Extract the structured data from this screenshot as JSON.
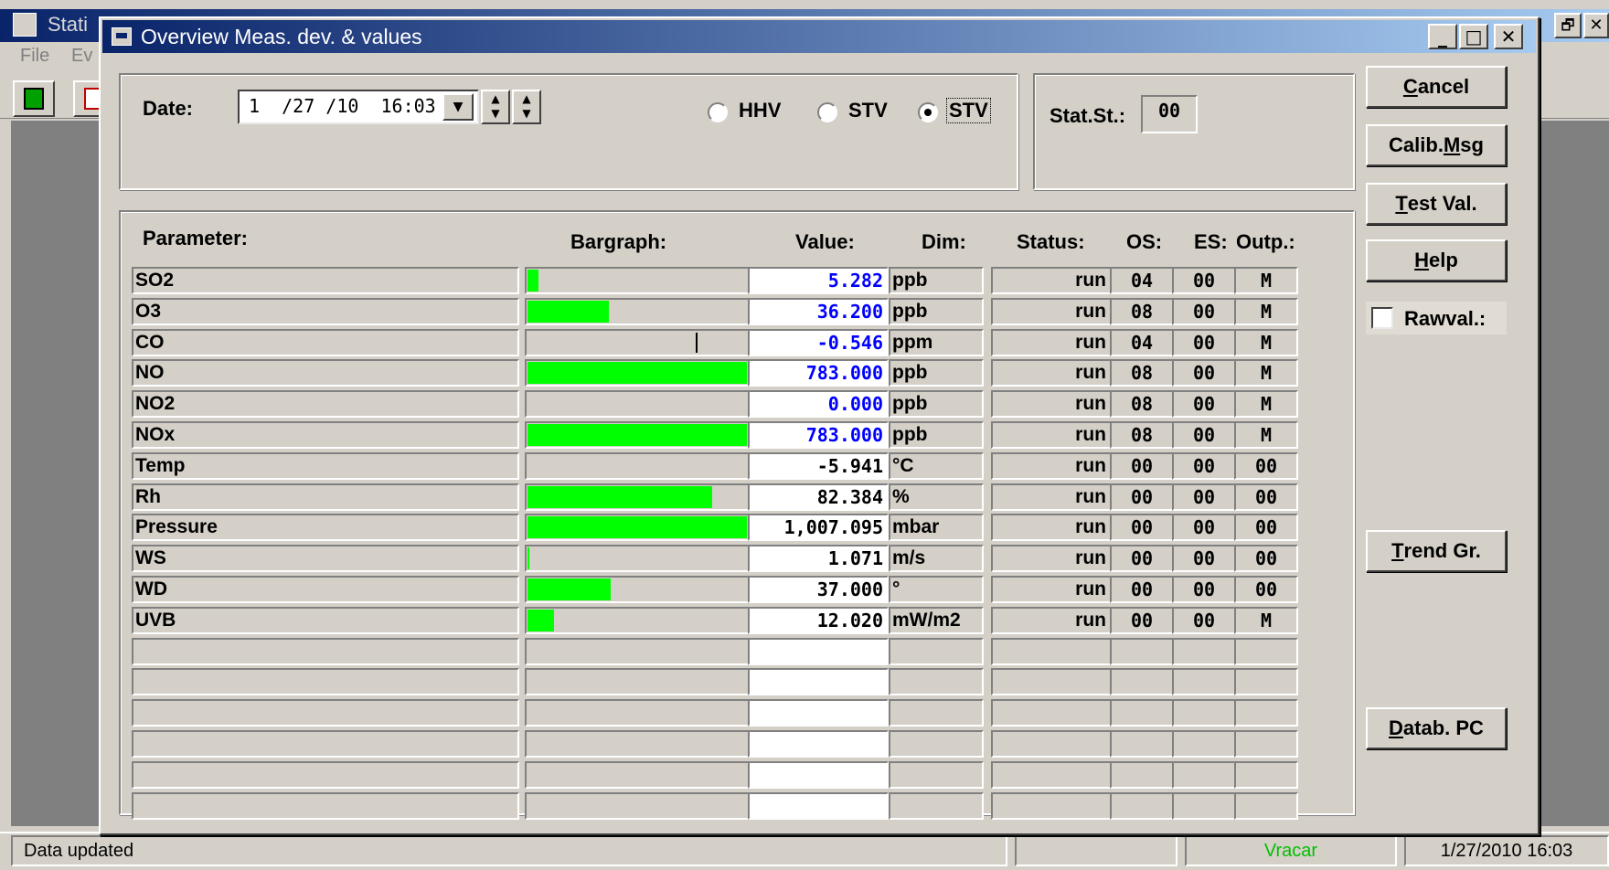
{
  "main_window": {
    "title": "Stati",
    "menu": [
      "File",
      "Ev"
    ]
  },
  "dialog": {
    "title": "Overview Meas. dev. & values",
    "caption_buttons": [
      "minimize-icon",
      "maximize-icon",
      "close-icon"
    ],
    "date_label": "Date:",
    "date_value": "1  /27 /10  16:03",
    "radios": [
      {
        "label": "HHV",
        "checked": false
      },
      {
        "label": "STV",
        "checked": false
      },
      {
        "label": "STV",
        "checked": true
      }
    ],
    "stat_label": "Stat.St.:",
    "stat_value": "00",
    "headers": {
      "parameter": "Parameter:",
      "bargraph": "Bargraph:",
      "value": "Value:",
      "dim": "Dim:",
      "status": "Status:",
      "os": "OS:",
      "es": "ES:",
      "outp": "Outp.:"
    },
    "rows": [
      {
        "param": "SO2",
        "bar": 0.05,
        "value": "5.282",
        "dim": "ppb",
        "status": "run",
        "os": "04",
        "es": "00",
        "outp": "M",
        "value_color": "#0000ff"
      },
      {
        "param": "O3",
        "bar": 0.37,
        "value": "36.200",
        "dim": "ppb",
        "status": "run",
        "os": "08",
        "es": "00",
        "outp": "M",
        "value_color": "#0000ff"
      },
      {
        "param": "CO",
        "bar": 0,
        "tick": 0.77,
        "value": "-0.546",
        "dim": "ppm",
        "status": "run",
        "os": "04",
        "es": "00",
        "outp": "M",
        "value_color": "#0000ff"
      },
      {
        "param": "NO",
        "bar": 1.0,
        "value": "783.000",
        "dim": "ppb",
        "status": "run",
        "os": "08",
        "es": "00",
        "outp": "M",
        "value_color": "#0000ff"
      },
      {
        "param": "NO2",
        "bar": 0,
        "value": "0.000",
        "dim": "ppb",
        "status": "run",
        "os": "08",
        "es": "00",
        "outp": "M",
        "value_color": "#0000ff"
      },
      {
        "param": "NOx",
        "bar": 1.0,
        "value": "783.000",
        "dim": "ppb",
        "status": "run",
        "os": "08",
        "es": "00",
        "outp": "M",
        "value_color": "#0000ff"
      },
      {
        "param": "Temp",
        "bar": 0,
        "value": "-5.941",
        "dim": "°C",
        "status": "run",
        "os": "00",
        "es": "00",
        "outp": "00",
        "value_color": "#000000"
      },
      {
        "param": "Rh",
        "bar": 0.84,
        "value": "82.384",
        "dim": "%",
        "status": "run",
        "os": "00",
        "es": "00",
        "outp": "00",
        "value_color": "#000000"
      },
      {
        "param": "Pressure",
        "bar": 1.0,
        "value": "1,007.095",
        "dim": "mbar",
        "status": "run",
        "os": "00",
        "es": "00",
        "outp": "00",
        "value_color": "#000000"
      },
      {
        "param": "WS",
        "bar": 0.01,
        "value": "1.071",
        "dim": "m/s",
        "status": "run",
        "os": "00",
        "es": "00",
        "outp": "00",
        "value_color": "#000000"
      },
      {
        "param": "WD",
        "bar": 0.38,
        "value": "37.000",
        "dim": "°",
        "status": "run",
        "os": "00",
        "es": "00",
        "outp": "00",
        "value_color": "#000000"
      },
      {
        "param": "UVB",
        "bar": 0.12,
        "value": "12.020",
        "dim": "mW/m2",
        "status": "run",
        "os": "00",
        "es": "00",
        "outp": "M",
        "value_color": "#000000"
      },
      {
        "param": "",
        "bar": 0,
        "value": "",
        "dim": "",
        "status": "",
        "os": "",
        "es": "",
        "outp": ""
      },
      {
        "param": "",
        "bar": 0,
        "value": "",
        "dim": "",
        "status": "",
        "os": "",
        "es": "",
        "outp": ""
      },
      {
        "param": "",
        "bar": 0,
        "value": "",
        "dim": "",
        "status": "",
        "os": "",
        "es": "",
        "outp": ""
      },
      {
        "param": "",
        "bar": 0,
        "value": "",
        "dim": "",
        "status": "",
        "os": "",
        "es": "",
        "outp": ""
      },
      {
        "param": "",
        "bar": 0,
        "value": "",
        "dim": "",
        "status": "",
        "os": "",
        "es": "",
        "outp": ""
      },
      {
        "param": "",
        "bar": 0,
        "value": "",
        "dim": "",
        "status": "",
        "os": "",
        "es": "",
        "outp": ""
      }
    ],
    "buttons": {
      "cancel": {
        "pre": "",
        "key": "C",
        "post": "ancel"
      },
      "calib": {
        "pre": "Calib.",
        "key": "M",
        "post": "sg"
      },
      "test": {
        "pre": "",
        "key": "T",
        "post": "est Val."
      },
      "help": {
        "pre": "",
        "key": "H",
        "post": "elp"
      },
      "trend": {
        "pre": "",
        "key": "T",
        "post": "rend Gr."
      },
      "datab": {
        "pre": "",
        "key": "D",
        "post": "atab. PC"
      }
    },
    "rawval_label": "Rawval.:",
    "rawval_checked": false
  },
  "statusbar": {
    "message": "Data updated",
    "station": "Vracar",
    "station_color": "#00c000",
    "datetime": "1/27/2010 16:03"
  },
  "colors": {
    "bar": "#00ff00",
    "title_start": "#0a246a",
    "title_end": "#a6caf0",
    "face": "#d4d0c8"
  }
}
